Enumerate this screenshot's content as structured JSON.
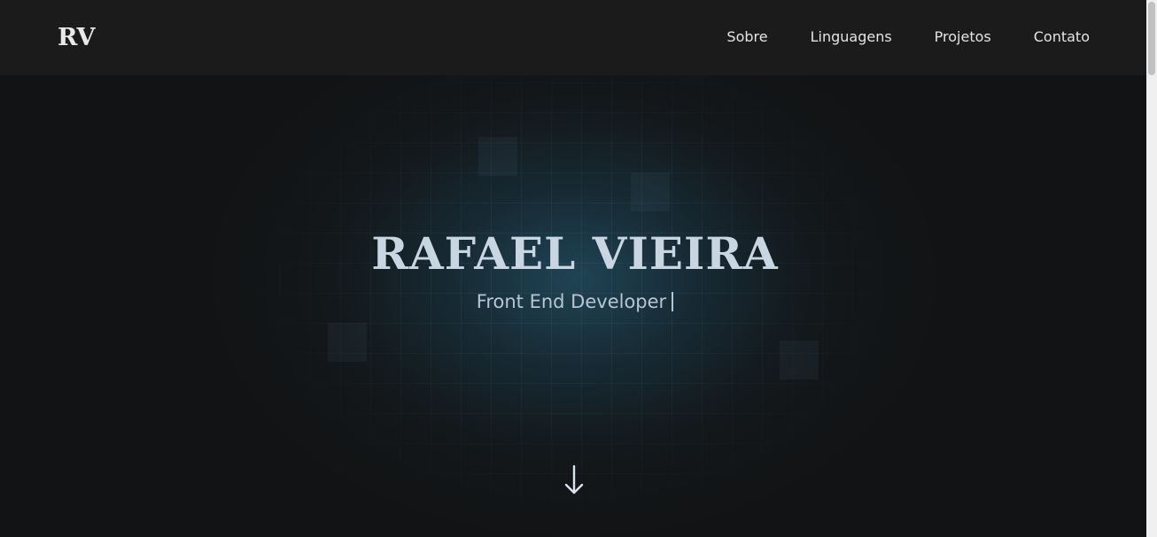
{
  "header": {
    "logo_text": "RV",
    "nav": [
      {
        "label": "Sobre"
      },
      {
        "label": "Linguagens"
      },
      {
        "label": "Projetos"
      },
      {
        "label": "Contato"
      }
    ]
  },
  "hero": {
    "title": "RAFAEL VIEIRA",
    "subtitle": "Front End Developer",
    "scroll_icon": "arrow-down-icon"
  },
  "colors": {
    "header_bg": "#1b1b1b",
    "page_bg": "#121314",
    "accent_glow": "#204658",
    "title": "#c8d6e2",
    "nav_text": "#e4e4e4"
  }
}
